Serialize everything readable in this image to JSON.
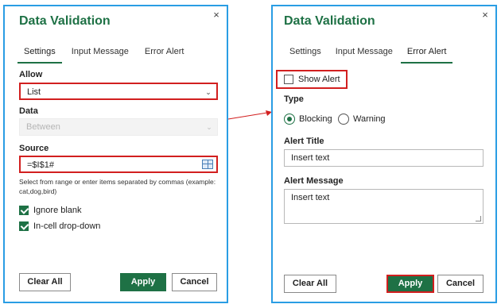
{
  "colors": {
    "accent": "#1e7145",
    "dialog_border": "#2a9de4",
    "highlight": "#d21f1f"
  },
  "left_dialog": {
    "title": "Data Validation",
    "close_glyph": "×",
    "tabs": [
      {
        "label": "Settings"
      },
      {
        "label": "Input Message"
      },
      {
        "label": "Error Alert"
      }
    ],
    "allow": {
      "label": "Allow",
      "value": "List"
    },
    "data": {
      "label": "Data",
      "value": "Between"
    },
    "source": {
      "label": "Source",
      "value": "=$I$1#",
      "helper": "Select from range or enter items separated by commas (example: cat,dog,bird)"
    },
    "checkboxes": [
      {
        "label": "Ignore blank",
        "checked": true
      },
      {
        "label": "In-cell drop-down",
        "checked": true
      }
    ],
    "buttons": {
      "clear": "Clear All",
      "apply": "Apply",
      "cancel": "Cancel"
    }
  },
  "right_dialog": {
    "title": "Data Validation",
    "close_glyph": "×",
    "tabs": [
      {
        "label": "Settings"
      },
      {
        "label": "Input Message"
      },
      {
        "label": "Error Alert"
      }
    ],
    "show_alert": {
      "label": "Show Alert",
      "checked": false
    },
    "type": {
      "label": "Type",
      "options": [
        {
          "label": "Blocking",
          "selected": true
        },
        {
          "label": "Warning",
          "selected": false
        }
      ]
    },
    "alert_title": {
      "label": "Alert Title",
      "value": "Insert text"
    },
    "alert_message": {
      "label": "Alert Message",
      "value": "Insert text"
    },
    "buttons": {
      "clear": "Clear All",
      "apply": "Apply",
      "cancel": "Cancel"
    }
  }
}
